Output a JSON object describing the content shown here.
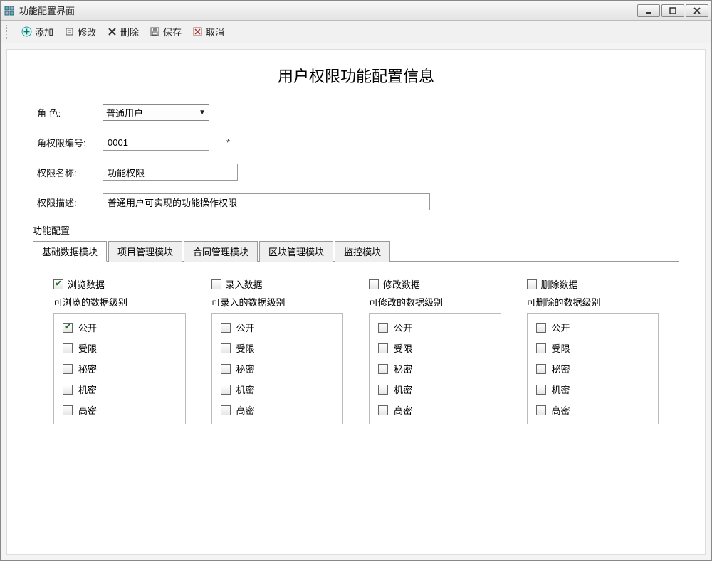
{
  "window": {
    "title": "功能配置界面"
  },
  "toolbar": {
    "add": "添加",
    "edit": "修改",
    "delete": "删除",
    "save": "保存",
    "cancel": "取消"
  },
  "page_title": "用户权限功能配置信息",
  "form": {
    "role_label": "角  色:",
    "role_value": "普通用户",
    "perm_id_label": "角权限编号:",
    "perm_id_value": "0001",
    "required_mark": "*",
    "perm_name_label": "权限名称:",
    "perm_name_value": "功能权限",
    "perm_desc_label": "权限描述:",
    "perm_desc_value": "普通用户可实现的功能操作权限"
  },
  "group": {
    "title": "功能配置"
  },
  "tabs": [
    {
      "label": "基础数据模块",
      "active": true
    },
    {
      "label": "项目管理模块",
      "active": false
    },
    {
      "label": "合同管理模块",
      "active": false
    },
    {
      "label": "区块管理模块",
      "active": false
    },
    {
      "label": "监控模块",
      "active": false
    }
  ],
  "columns": [
    {
      "main_label": "浏览数据",
      "main_checked": true,
      "sub_label": "可浏览的数据级别",
      "levels": [
        {
          "label": "公开",
          "checked": true
        },
        {
          "label": "受限",
          "checked": false
        },
        {
          "label": "秘密",
          "checked": false
        },
        {
          "label": "机密",
          "checked": false
        },
        {
          "label": "高密",
          "checked": false
        }
      ]
    },
    {
      "main_label": "录入数据",
      "main_checked": false,
      "sub_label": "可录入的数据级别",
      "levels": [
        {
          "label": "公开",
          "checked": false
        },
        {
          "label": "受限",
          "checked": false
        },
        {
          "label": "秘密",
          "checked": false
        },
        {
          "label": "机密",
          "checked": false
        },
        {
          "label": "高密",
          "checked": false
        }
      ]
    },
    {
      "main_label": "修改数据",
      "main_checked": false,
      "sub_label": "可修改的数据级别",
      "levels": [
        {
          "label": "公开",
          "checked": false
        },
        {
          "label": "受限",
          "checked": false
        },
        {
          "label": "秘密",
          "checked": false
        },
        {
          "label": "机密",
          "checked": false
        },
        {
          "label": "高密",
          "checked": false
        }
      ]
    },
    {
      "main_label": "删除数据",
      "main_checked": false,
      "sub_label": "可删除的数据级别",
      "levels": [
        {
          "label": "公开",
          "checked": false
        },
        {
          "label": "受限",
          "checked": false
        },
        {
          "label": "秘密",
          "checked": false
        },
        {
          "label": "机密",
          "checked": false
        },
        {
          "label": "高密",
          "checked": false
        }
      ]
    }
  ]
}
